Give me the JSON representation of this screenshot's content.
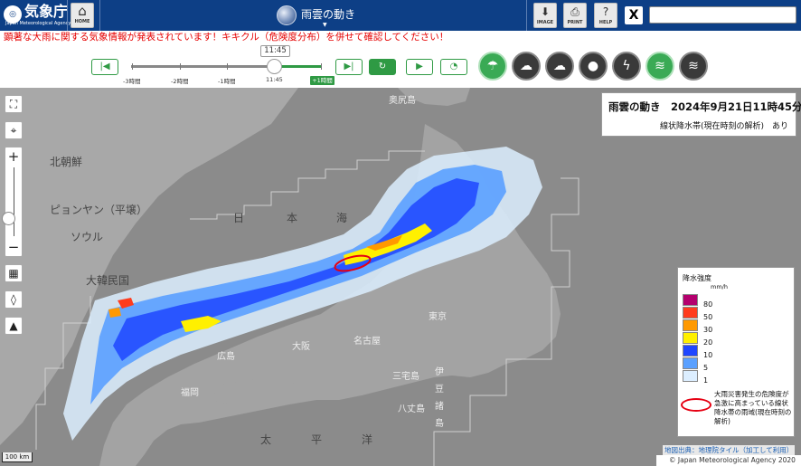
{
  "header": {
    "logo_ja": "気象庁",
    "logo_en": "Japan Meteorological Agency",
    "home_label": "HOME",
    "page_title": "雨雲の動き",
    "image_label": "IMAGE",
    "print_label": "PRINT",
    "help_label": "HELP",
    "x_label": "X",
    "search_value": ""
  },
  "alert": "顕著な大雨に関する気象情報が発表されています！キキクル（危険度分布）を併せて確認してください！",
  "timeline": {
    "current_time": "11:45",
    "ticks": [
      "-3時間",
      "-2時間",
      "-1時間",
      "11:45"
    ],
    "future_label": "+1時間"
  },
  "info": {
    "title": "雨雲の動き　2024年9月21日11時45分",
    "subtitle": "線状降水帯(現在時刻の解析)　あり"
  },
  "legend": {
    "title": "降水強度",
    "unit": "mm/h",
    "entries": [
      {
        "label": "80",
        "color": "#b4006e"
      },
      {
        "label": "50",
        "color": "#ff3c1e"
      },
      {
        "label": "30",
        "color": "#ff9900"
      },
      {
        "label": "20",
        "color": "#fff000"
      },
      {
        "label": "10",
        "color": "#1e46ff"
      },
      {
        "label": "5",
        "color": "#5aa0ff"
      },
      {
        "label": "1",
        "color": "#dceeff"
      }
    ],
    "band_desc": "大雨災害発生の危険度が急激に高まっている線状降水帯の雨域(現在時刻の解析)"
  },
  "map": {
    "labels": {
      "okushiri": "奥尻島",
      "north_korea": "北朝鮮",
      "pyongyang": "ピョンヤン（平壌）",
      "seoul": "ソウル",
      "korea": "大韓民国",
      "nihon": "日",
      "hon": "本",
      "umi": "海",
      "tokyo": "東京",
      "nagoya": "名古屋",
      "osaka": "大阪",
      "hiroshima": "広島",
      "fukuoka": "福岡",
      "miyake": "三宅島",
      "i": "伊",
      "zu": "豆",
      "sho": "諸",
      "to": "島",
      "hachijo": "八丈島",
      "tai": "太",
      "hei": "平",
      "yo": "洋"
    },
    "attribution": "地図出典：地理院タイル（加工して利用）",
    "copyright": "© Japan Meteorological Agency 2020",
    "scale": "100 km"
  },
  "icons": {
    "home": "home-icon",
    "image": "download-icon",
    "print": "printer-icon",
    "help": "question-icon"
  }
}
